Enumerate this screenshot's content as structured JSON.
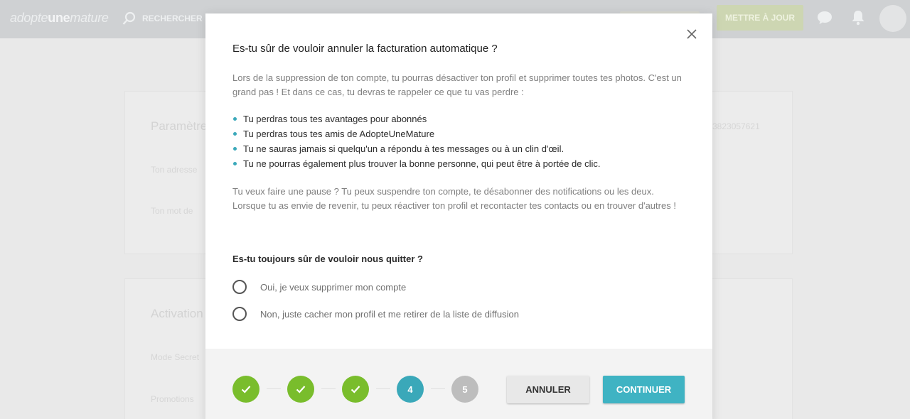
{
  "background": {
    "logo_prefix": "adopte",
    "logo_brand": "une",
    "logo_suffix": "mature",
    "search_label": "RECHERCHER",
    "upgrade_label": "METTRE À JOUR",
    "card1_title": "Paramètre",
    "card1_id": "3823057621",
    "card1_line1": "Ton adresse",
    "card1_line2": "Ton mot de",
    "card2_title": "Activation",
    "card2_line1": "Mode Secret",
    "card2_line2": "Promotions"
  },
  "modal": {
    "title": "Es-tu sûr de vouloir annuler la facturation automatique ?",
    "intro": "Lors de la suppression de ton compte, tu pourras désactiver ton profil et supprimer toutes tes photos. C'est un grand pas ! Et dans ce cas, tu devras te rappeler ce que tu vas perdre :",
    "bullets": [
      "Tu perdras tous tes avantages pour abonnés",
      "Tu perdras tous tes amis de AdopteUneMature",
      "Tu ne sauras jamais si quelqu'un a répondu à tes messages ou à un clin d'œil.",
      "Tu ne pourras également plus trouver la bonne personne, qui peut être à portée de clic."
    ],
    "pause_text": "Tu veux faire une pause ? Tu peux suspendre ton compte, te désabonner des notifications ou les deux. Lorsque tu as envie de revenir, tu peux réactiver ton profil et recontacter tes contacts ou en trouver d'autres !",
    "question": "Es-tu toujours sûr de vouloir nous quitter ?",
    "options": [
      "Oui, je veux supprimer mon compte",
      "Non, juste cacher mon profil et me retirer de la liste de diffusion"
    ]
  },
  "steps": {
    "step4": "4",
    "step5": "5",
    "current": 4,
    "total": 5
  },
  "buttons": {
    "cancel": "ANNULER",
    "continue": "CONTINUER"
  },
  "colors": {
    "accent": "#3fb3c3",
    "done": "#79bd2c",
    "todo": "#bdbdbd"
  }
}
